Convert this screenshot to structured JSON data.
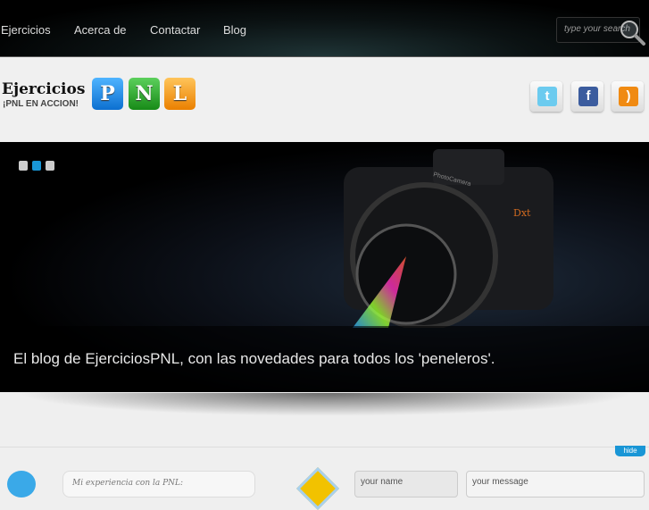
{
  "nav": {
    "items": [
      "Ejercicios",
      "Acerca de",
      "Contactar",
      "Blog"
    ]
  },
  "search": {
    "placeholder": "type your search"
  },
  "logo": {
    "text": "Ejercicios",
    "tagline": "¡PNL EN ACCION!",
    "tiles": [
      "P",
      "N",
      "L"
    ]
  },
  "social": [
    "twitter",
    "facebook",
    "rss"
  ],
  "slider": {
    "caption": "El blog de EjerciciosPNL, con las novedades para todos los 'peneleros'.",
    "camera_brand": "Dxt",
    "camera_label": "PhotoCamera",
    "active_slide": 2,
    "slide_count": 3
  },
  "footer": {
    "hide_label": "hide",
    "bubble_text": "Mi experiencia con la PNL:",
    "name_placeholder": "your name",
    "message_placeholder": "your message"
  },
  "colors": {
    "accent": "#1996d6",
    "tile_p": "#1e88e0",
    "tile_n": "#2ea52e",
    "tile_l": "#f19a1a"
  }
}
